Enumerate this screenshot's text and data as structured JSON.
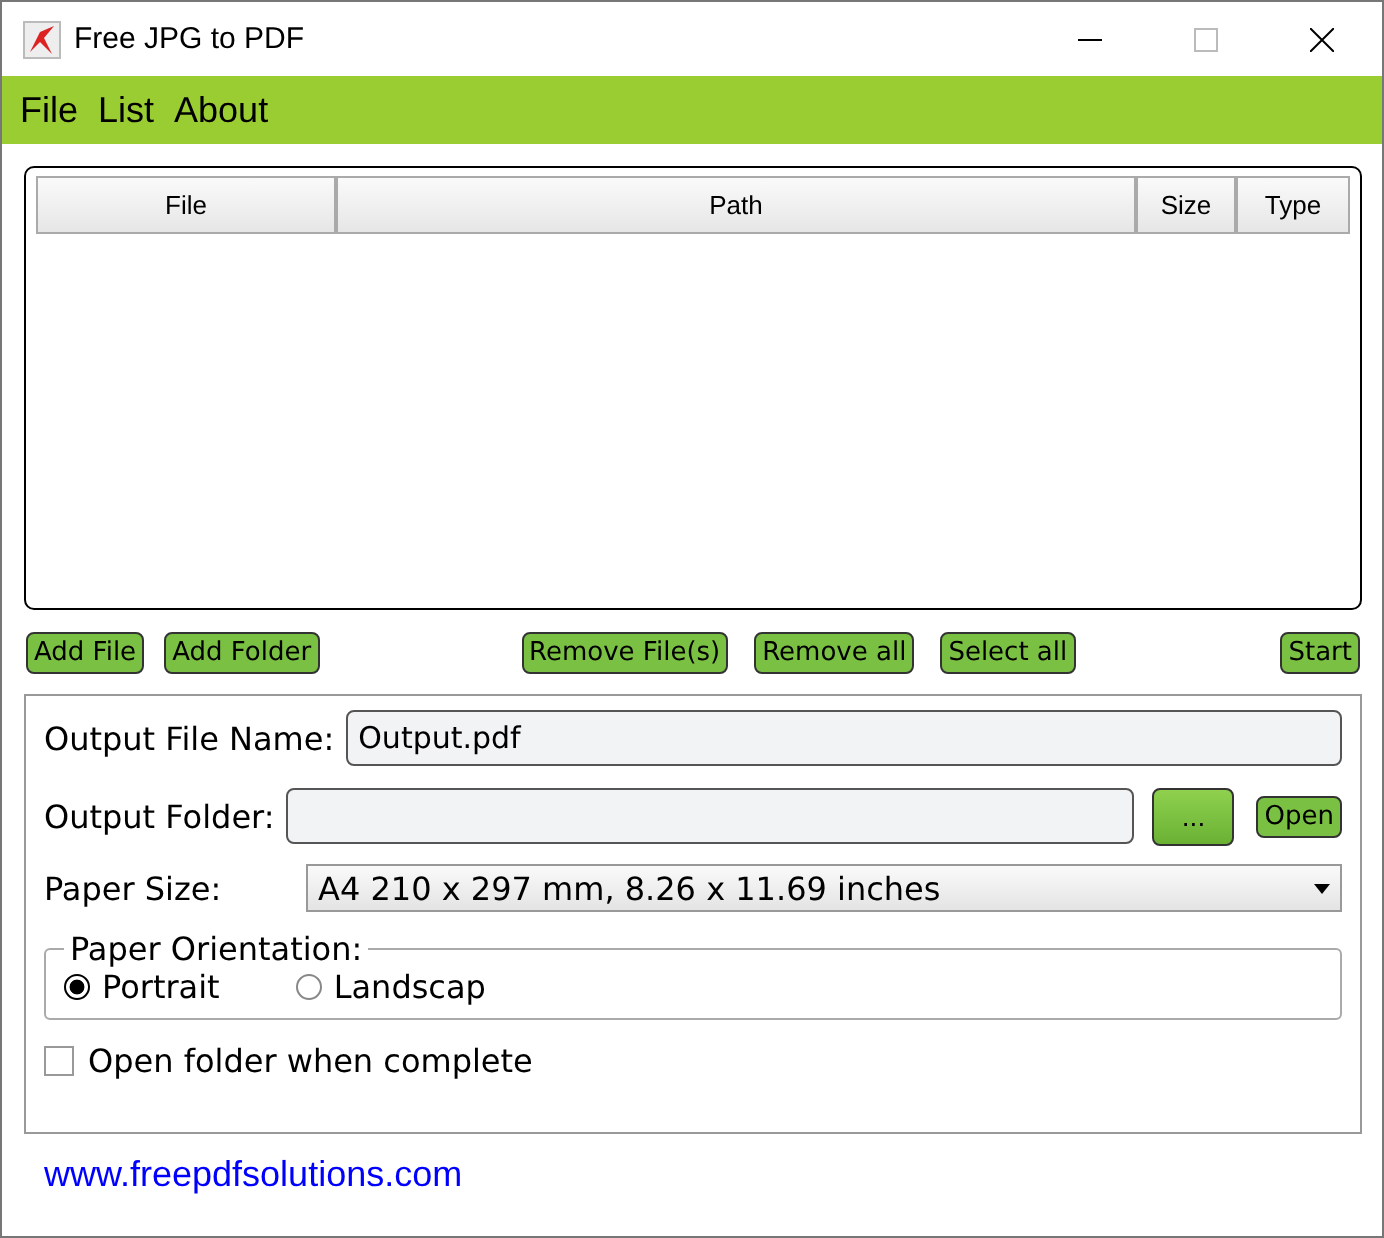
{
  "window": {
    "title": "Free JPG to PDF"
  },
  "menu": [
    "File",
    "List",
    "About"
  ],
  "table": {
    "columns": [
      "File",
      "Path",
      "Size",
      "Type"
    ]
  },
  "buttons": [
    "Add File",
    "Add Folder",
    "Remove File(s)",
    "Remove all",
    "Select all",
    "Start"
  ],
  "output_file_name": {
    "label": "Output File Name:",
    "value": "Output.pdf"
  },
  "output_folder": {
    "label": "Output Folder:",
    "browse": "...",
    "open": "Open"
  },
  "paper_size": {
    "label": "Paper Size:",
    "value": "A4 210 x 297 mm, 8.26 x 11.69 inches"
  },
  "paper_orientation": {
    "label": "Paper Orientation:",
    "options": [
      {
        "label": "Portrait",
        "selected": true
      },
      {
        "label": "Landscap",
        "selected": false
      }
    ]
  },
  "open_folder_when_complete": {
    "label": "Open folder when complete",
    "checked": false
  },
  "link": "www.freepdfsolutions.com"
}
